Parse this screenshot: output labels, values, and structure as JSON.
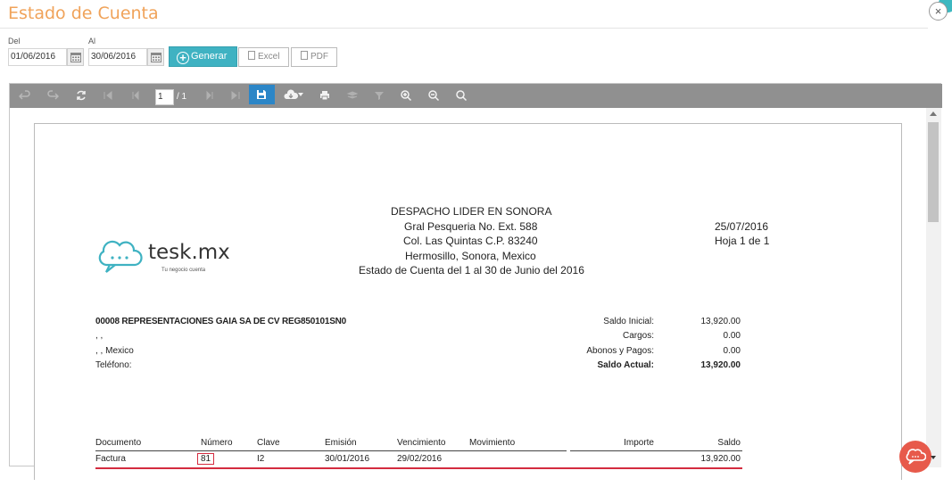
{
  "window": {
    "title": "Estado de Cuenta",
    "close_label": "×"
  },
  "filters": {
    "from_label": "Del",
    "from_value": "01/06/2016",
    "to_label": "Al",
    "to_value": "30/06/2016",
    "generate_label": "Generar",
    "excel_label": "Excel",
    "pdf_label": "PDF"
  },
  "viewer": {
    "page_current": "1",
    "page_total": "/ 1"
  },
  "report": {
    "company": {
      "name": "DESPACHO LIDER EN SONORA",
      "address1": "Gral Pesqueria No. Ext. 588",
      "address2": "Col. Las Quintas C.P. 83240",
      "city": "Hermosillo, Sonora, Mexico",
      "subtitle": "Estado de Cuenta del 1 al 30 de Junio del 2016"
    },
    "date": "25/07/2016",
    "page": "Hoja 1 de 1",
    "logo": {
      "brand": "tesk.mx",
      "tagline": "Tu negocio cuenta"
    },
    "client": {
      "name": "00008 REPRESENTACIONES GAIA SA DE CV REG850101SN0",
      "line1": ", ,",
      "line2": ", , Mexico",
      "phone_label": "Teléfono:"
    },
    "summary": {
      "initial_label": "Saldo Inicial:",
      "initial_value": "13,920.00",
      "charges_label": "Cargos:",
      "charges_value": "0.00",
      "payments_label": "Abonos y Pagos:",
      "payments_value": "0.00",
      "current_label": "Saldo Actual:",
      "current_value": "13,920.00"
    },
    "table": {
      "headers": [
        "Documento",
        "Número",
        "Clave",
        "Emisión",
        "Vencimiento",
        "Movimiento",
        "Importe",
        "Saldo"
      ],
      "rows": [
        [
          "Factura",
          "81",
          "I2",
          "30/01/2016",
          "29/02/2016",
          "",
          "",
          "13,920.00"
        ]
      ]
    }
  },
  "colors": {
    "title": "#f0a35a",
    "accent": "#3fb2c2",
    "toolbar": "#909090",
    "active": "#2c86c7",
    "rule": "#d42b3f",
    "fab": "#e75a4b"
  },
  "icons": [
    "undo-icon",
    "redo-icon",
    "refresh-icon",
    "first-page-icon",
    "prev-page-icon",
    "next-page-icon",
    "last-page-icon",
    "save-icon",
    "download-icon",
    "print-icon",
    "layers-icon",
    "filter-icon",
    "zoom-in-icon",
    "zoom-out-icon",
    "zoom-icon",
    "calendar-icon",
    "cloud-chat-icon"
  ]
}
